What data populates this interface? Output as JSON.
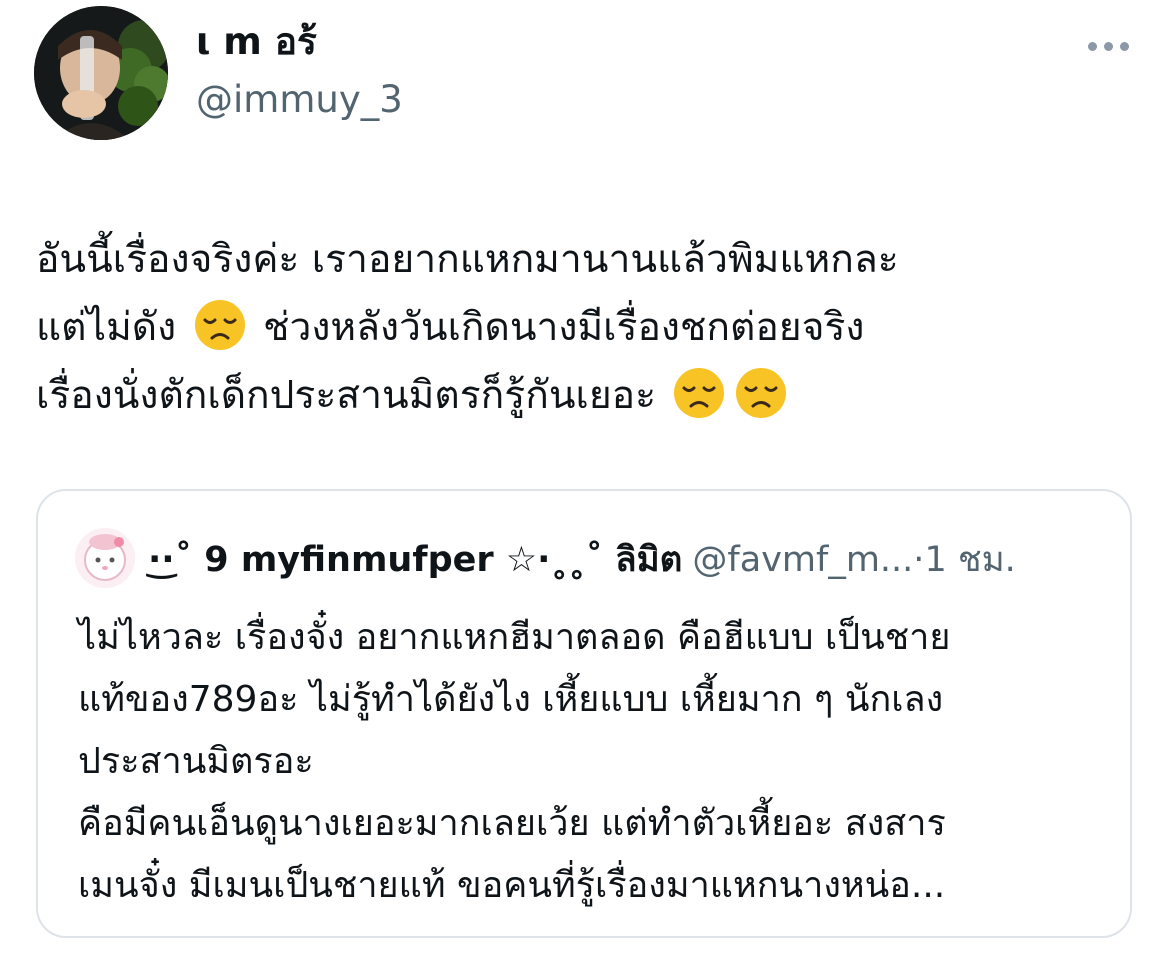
{
  "tweet": {
    "author": {
      "display_name": "ι m อร้",
      "handle": "@immuy_3",
      "avatar": "profile-photo"
    },
    "more_icon": "more-horizontal-icon",
    "text_lines": [
      {
        "segments": [
          "อันนี้เรื่องจริงค่ะ เราอยากแหกมานานแล้วพิมแหกละ"
        ]
      },
      {
        "before": "แต่ไม่ดัง",
        "after": "ช่วงหลังวันเกิดนางมีเรื่องชกต่อยจริง"
      },
      {
        "before": "เรื่องนั่งตักเด็กประสานมิตรก็รู้กันเยอะ"
      }
    ],
    "emoji": "disappointed-face-emoji"
  },
  "quote": {
    "author": {
      "display_name": "·͜·˚ 9 myfinmufper ☆·˳˳˚ ลิมิต",
      "handle": "@favmf_m...",
      "separator": "·",
      "time": "1 ชม."
    },
    "text_lines": [
      "ไม่ไหวละ เรื่องจั๋ง อยากแหกฮีมาตลอด คือฮีแบบ เป็นชาย",
      "แท้ของ789อะ ไม่รู้ทำได้ยังไง เหี้ยแบบ เหี้ยมาก ๆ นักเลง",
      "ประสานมิตรอะ",
      "คือมีคนเอ็นดูนางเยอะมากเลยเว้ย แต่ทำตัวเหี้ยอะ สงสาร",
      "เมนจั๋ง มีเมนเป็นชายแท้ ขอคนที่รู้เรื่องมาแหกนางหน่อ..."
    ]
  },
  "colors": {
    "text_primary": "#0f1419",
    "text_secondary": "#536471",
    "card_border": "#dde3e8",
    "emoji_yellow": "#f7c325"
  }
}
